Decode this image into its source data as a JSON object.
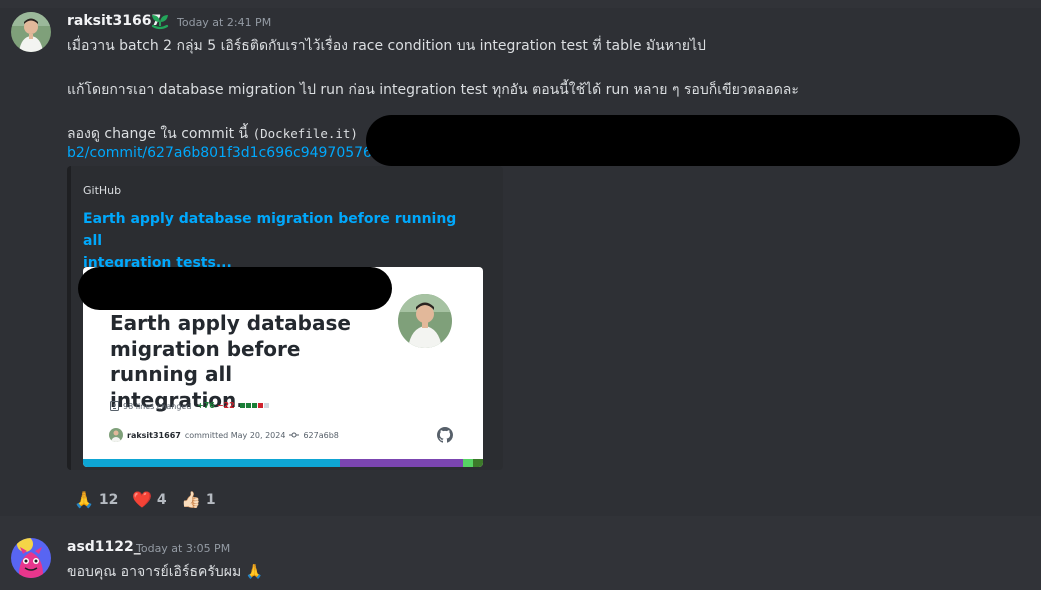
{
  "message1": {
    "username": "raksit31667",
    "timestamp": "Today at 2:41 PM",
    "line1": "เมื่อวาน batch 2 กลุ่ม 5 เอิร์ธติดกับเราไว้เรื่อง race condition บน integration test  ที่ table มันหายไป",
    "line2": "แก้โดยการเอา database migration ไป run ก่อน integration test ทุกอัน ตอนนี้ใช้ได้ run หลาย ๆ รอบก็เขียวตลอดละ",
    "line3_text": "ลองดู change ใน commit นี้ ",
    "line3_code": "(Dockefile.it)",
    "link_text": "b2/commit/627a6b801f3d1c696c949705767a"
  },
  "embed": {
    "provider": "GitHub",
    "title_line1": "Earth apply database migration before running all",
    "title_line2": "integration tests...",
    "card": {
      "title": "Earth apply database migration before running all integration...",
      "lines_changed": "98 lines changed",
      "additions": "+76",
      "deletions": "−22",
      "author": "raksit31667",
      "committed": "committed May 20, 2024",
      "sha": "627a6b8"
    }
  },
  "reactions": [
    {
      "emoji": "🙏",
      "count": "12"
    },
    {
      "emoji": "❤️",
      "count": "4"
    },
    {
      "emoji": "👍🏻",
      "count": "1"
    }
  ],
  "message2": {
    "username": "asd1122_",
    "timestamp": "Today at 3:05 PM",
    "text": "ขอบคุณ อาจารย์เอิร์ธครับผม 🙏"
  },
  "icons": {
    "badge": "leaf-badge-icon",
    "github": "github-icon"
  },
  "colors": {
    "background": "#313338",
    "link": "#00a8fc",
    "badge_green": "#23a55a"
  }
}
